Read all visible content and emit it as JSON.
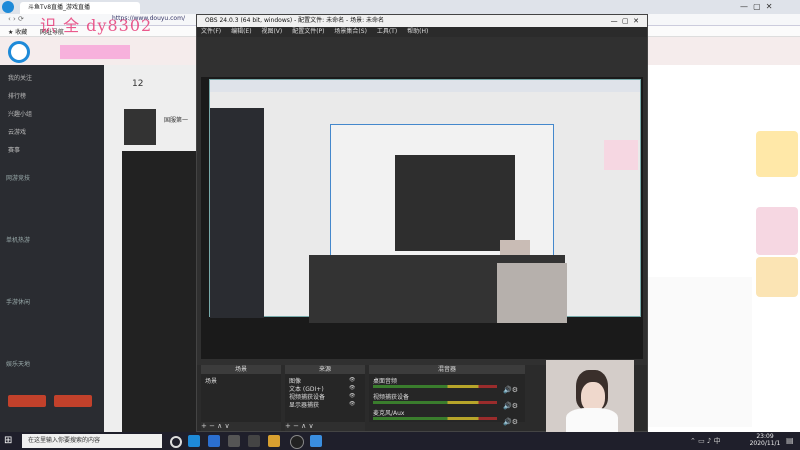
{
  "browser": {
    "tab_title": "斗鱼Tv8直播_游戏直播",
    "url": "https://www.douyu.com/",
    "bookmark_label": "收藏",
    "bookmark_items": [
      "网址导航"
    ]
  },
  "watermark": "识 全 dy8302",
  "left_nav": {
    "items": [
      "我的关注",
      "排行榜",
      "兴趣小组",
      "云游戏",
      "赛事"
    ],
    "section_titles": [
      "网游竞技",
      "单机热游",
      "手游休闲",
      "娱乐天地"
    ]
  },
  "main_page": {
    "number": "12",
    "name": "国服第一"
  },
  "obs": {
    "title": "OBS 24.0.3 (64 bit, windows) - 配置文件: 未命名 - 场景: 未命名",
    "menu": [
      "文件(F)",
      "编辑(E)",
      "视图(V)",
      "配置文件(P)",
      "场景集合(S)",
      "工具(T)",
      "帮助(H)"
    ],
    "docks": {
      "scenes": {
        "title": "场景",
        "items": [
          "场景"
        ]
      },
      "sources": {
        "title": "来源",
        "items": [
          "图像",
          "文本 (GDI+)",
          "视频捕获设备",
          "显示器捕获"
        ]
      },
      "mixer": {
        "title": "混音器",
        "channels": [
          "桌面音频",
          "视频捕获设备",
          "麦克风/Aux"
        ]
      }
    },
    "dock_tools": "+ − ∧ ∨"
  },
  "taskbar": {
    "search_placeholder": "在这里输入你要搜索的内容",
    "time": "23:09",
    "date": "2020/11/1"
  },
  "colors": {
    "accent": "#e8601c",
    "obs_bg": "#303030",
    "taskbar": "#1f1f2b"
  }
}
